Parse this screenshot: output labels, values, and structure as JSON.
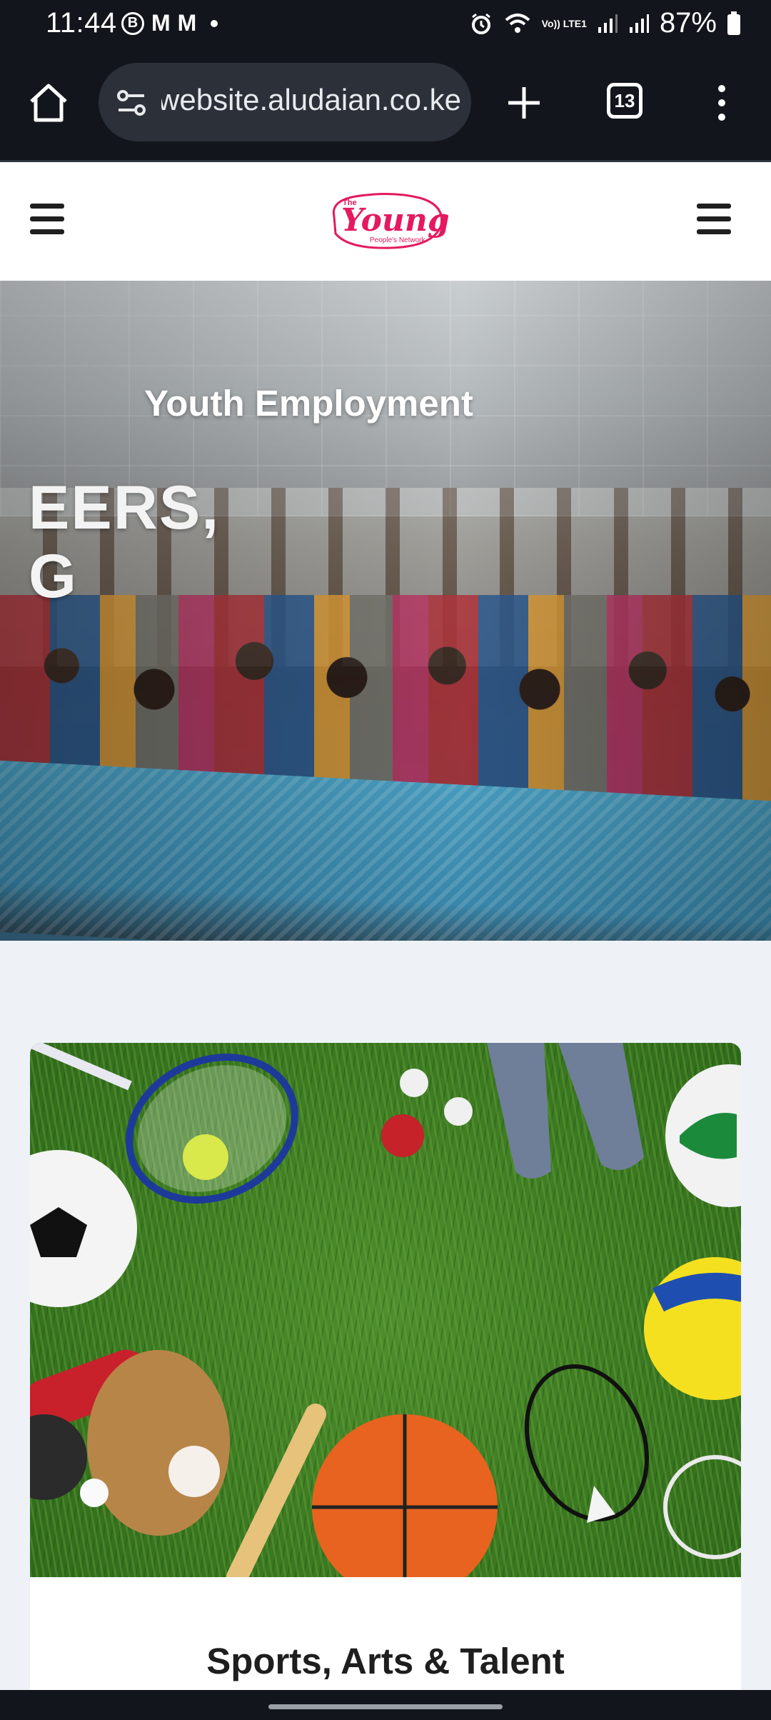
{
  "status_bar": {
    "time": "11:44",
    "battery": "87%",
    "left_icons": [
      "b-circle-icon",
      "gmail-icon",
      "gmail-icon",
      "dot-icon"
    ],
    "right_icons": [
      "alarm-icon",
      "wifi-icon",
      "volte-icon",
      "signal-icon",
      "signal-icon",
      "battery-icon"
    ],
    "volte_label": "Vo)) LTE1"
  },
  "browser": {
    "url": "website.aludaian.co.ke",
    "tab_count": "13"
  },
  "site_header": {
    "logo_text": "Young",
    "logo_small_top": "The",
    "logo_small_bottom": "People's Network",
    "brand_color": "#e5195f"
  },
  "hero": {
    "title": "Youth Employment",
    "big_line_1": "EERS,",
    "big_line_2": "G"
  },
  "card": {
    "title": "Sports, Arts & Talent"
  }
}
